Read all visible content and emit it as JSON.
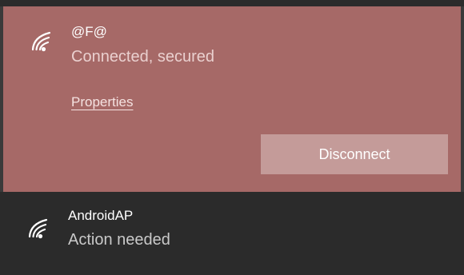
{
  "networks": [
    {
      "name": "@F@",
      "status": "Connected, secured",
      "icon": "wifi-signal-icon",
      "properties_label": "Properties",
      "disconnect_label": "Disconnect",
      "highlight_color": "#a66967"
    },
    {
      "name": "AndroidAP",
      "status": "Action needed",
      "icon": "wifi-signal-icon"
    }
  ]
}
